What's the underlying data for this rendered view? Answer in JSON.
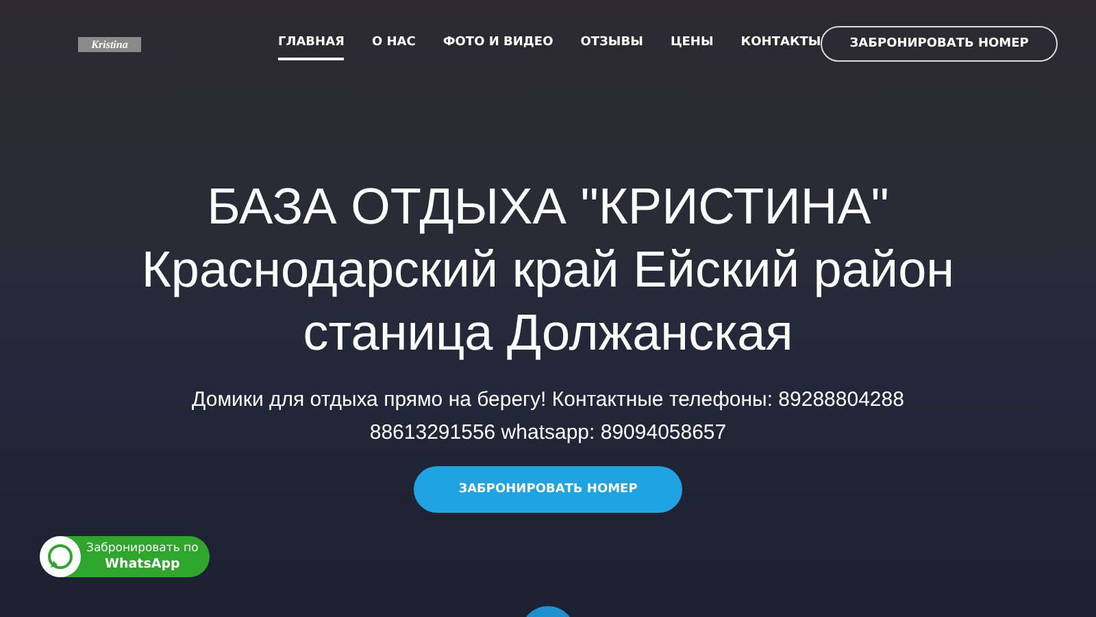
{
  "header": {
    "logo": "Kristina",
    "nav": [
      {
        "label": "ГЛАВНАЯ",
        "selected": true
      },
      {
        "label": "О НАС",
        "selected": false
      },
      {
        "label": "ФОТО И ВИДЕО",
        "selected": false
      },
      {
        "label": "ОТЗЫВЫ",
        "selected": false
      },
      {
        "label": "ЦЕНЫ",
        "selected": false
      },
      {
        "label": "КОНТАКТЫ",
        "selected": false
      }
    ],
    "book_button": "ЗАБРОНИРОВАТЬ НОМЕР"
  },
  "hero": {
    "title_lines": [
      "БАЗА ОТДЫХА \"КРИСТИНА\"",
      "Краснодарский край Ейский район",
      "станица Должанская"
    ],
    "subtitle": "Домики для отдыха прямо на берегу! Контактные телефоны: 89288804288 88613291556 whatsapp: 89094058657",
    "button": "ЗАБРОНИРОВАТЬ НОМЕР"
  },
  "whatsapp_button": {
    "line_1": "Забронировать по",
    "line_2": "WhatsApp"
  }
}
